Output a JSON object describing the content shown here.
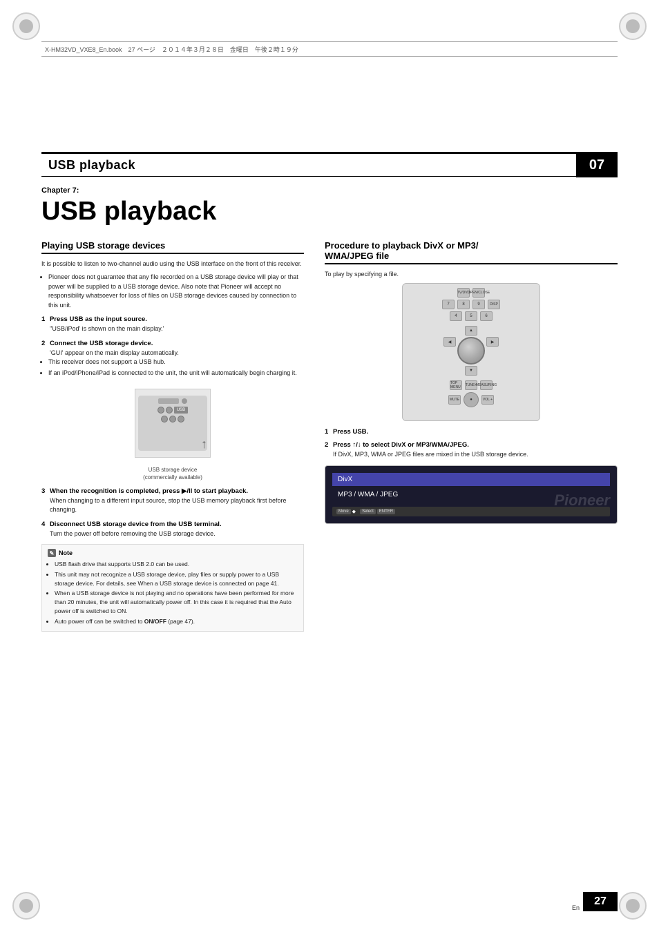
{
  "page": {
    "number": "27",
    "lang": "En"
  },
  "header": {
    "fileinfo": "X-HM32VD_VXE8_En.book　27 ページ　２０１４年３月２８日　金曜日　午後２時１９分"
  },
  "chapter_band": {
    "title": "USB playback",
    "badge": "07"
  },
  "chapter": {
    "label": "Chapter 7:",
    "main_title": "USB playback"
  },
  "left_col": {
    "section_title": "Playing USB storage devices",
    "intro": "It is possible to listen to two-channel audio using the USB interface on the front of this receiver.",
    "bullets": [
      "Pioneer does not guarantee that any file recorded on a USB storage device will play or that power will be supplied to a USB storage device. Also note that Pioneer will accept no responsibility whatsoever for loss of files on USB storage devices caused by connection to this unit."
    ],
    "steps": [
      {
        "num": "1",
        "title": "Press USB as the input source.",
        "body": "'USB/iPod' is shown on the main display."
      },
      {
        "num": "2",
        "title": "Connect the USB storage device.",
        "body": "'GUI' appear on the main display automatically.",
        "sub_bullets": [
          "This receiver does not support a USB hub.",
          "If an iPod/iPhone/iPad is connected to the unit, the unit will automatically begin charging it."
        ]
      }
    ],
    "device_caption": "USB storage device\n(commercially available)",
    "steps2": [
      {
        "num": "3",
        "title": "When the recognition is completed, press ▶/II to start playback.",
        "body": "When changing to a different input source, stop the USB memory playback first before changing."
      },
      {
        "num": "4",
        "title": "Disconnect USB storage device from the USB terminal.",
        "body": "Turn the power off before removing the USB storage device."
      }
    ],
    "note": {
      "title": "Note",
      "items": [
        "USB flash drive that supports USB 2.0 can be used.",
        "This unit may not recognize a USB storage device, play files or supply power to a USB storage device. For details, see When a USB storage device is connected on page 41.",
        "When a USB storage device is not playing and no operations have been performed for more than 20 minutes, the unit will automatically power off. In this case it is required that the Auto power off is switched to ON.",
        "Auto power off can be switched to ON/OFF (page 47)."
      ]
    }
  },
  "right_col": {
    "section_title": "Procedure to playback DivX or MP3/\nWMA/JPEG file",
    "intro": "To play by specifying a file.",
    "step1": {
      "num": "1",
      "title": "Press USB."
    },
    "step2": {
      "num": "2",
      "title": "Press ↑/↓ to select DivX or MP3/WMA/JPEG.",
      "body": "If DivX, MP3, WMA or JPEG files are mixed in the USB storage device."
    },
    "screen_menu": {
      "items": [
        "DivX",
        "MP3 / WMA / JPEG"
      ],
      "selected": 0
    },
    "screen_bottom": [
      {
        "key": "Move",
        "icon": "◆"
      },
      {
        "key": "Select",
        "icon": "ENTER"
      }
    ]
  }
}
